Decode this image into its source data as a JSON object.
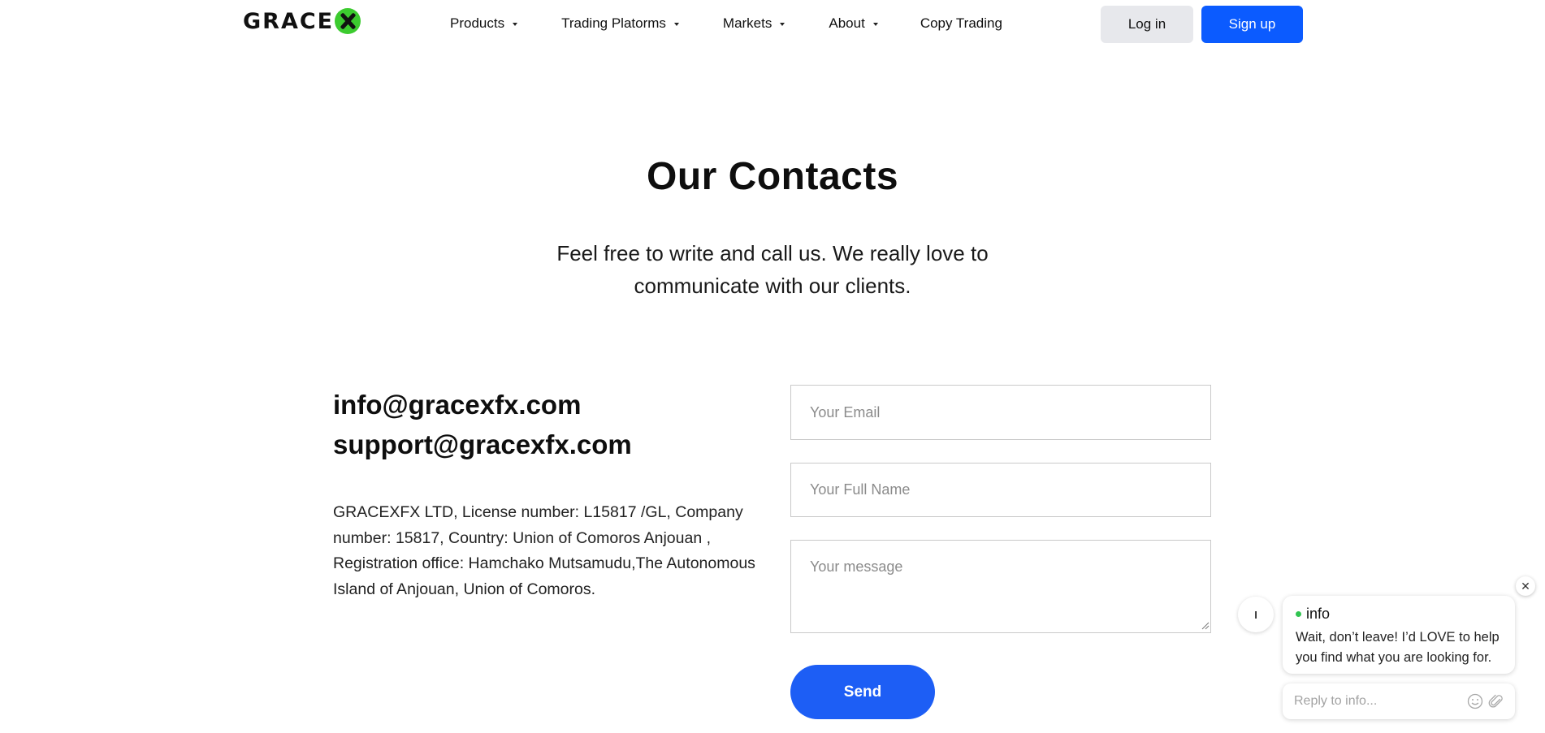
{
  "header": {
    "logo_text": "GRACE",
    "nav": [
      {
        "label": "Products",
        "has_dropdown": true
      },
      {
        "label": "Trading Platorms",
        "has_dropdown": true
      },
      {
        "label": "Markets",
        "has_dropdown": true
      },
      {
        "label": "About",
        "has_dropdown": true
      },
      {
        "label": "Copy Trading",
        "has_dropdown": false
      }
    ],
    "login_label": "Log in",
    "signup_label": "Sign up"
  },
  "hero": {
    "title": "Our Contacts",
    "subtitle": "Feel free to write and call us. We really love to communicate with our clients."
  },
  "contacts": {
    "emails": [
      "info@gracexfx.com",
      "support@gracexfx.com"
    ],
    "company_info": "GRACEXFX LTD, License number: L15817 /GL, Company number: 15817, Country: Union of Comoros Anjouan , Registration office: Hamchako Mutsamudu,The Autonomous Island of Anjouan, Union of Comoros."
  },
  "form": {
    "email_placeholder": "Your Email",
    "name_placeholder": "Your Full Name",
    "message_placeholder": "Your message",
    "send_label": "Send"
  },
  "chat": {
    "avatar_letter": "I",
    "agent_name": "info",
    "message": "Wait, don’t leave! I’d LOVE to help you find what you are looking for.",
    "reply_placeholder": "Reply to info...",
    "close_symbol": "✕"
  },
  "colors": {
    "brand_blue": "#0b5bff",
    "send_blue": "#1d5ef5",
    "logo_green": "#3ccb2f",
    "online_green": "#31c451"
  }
}
